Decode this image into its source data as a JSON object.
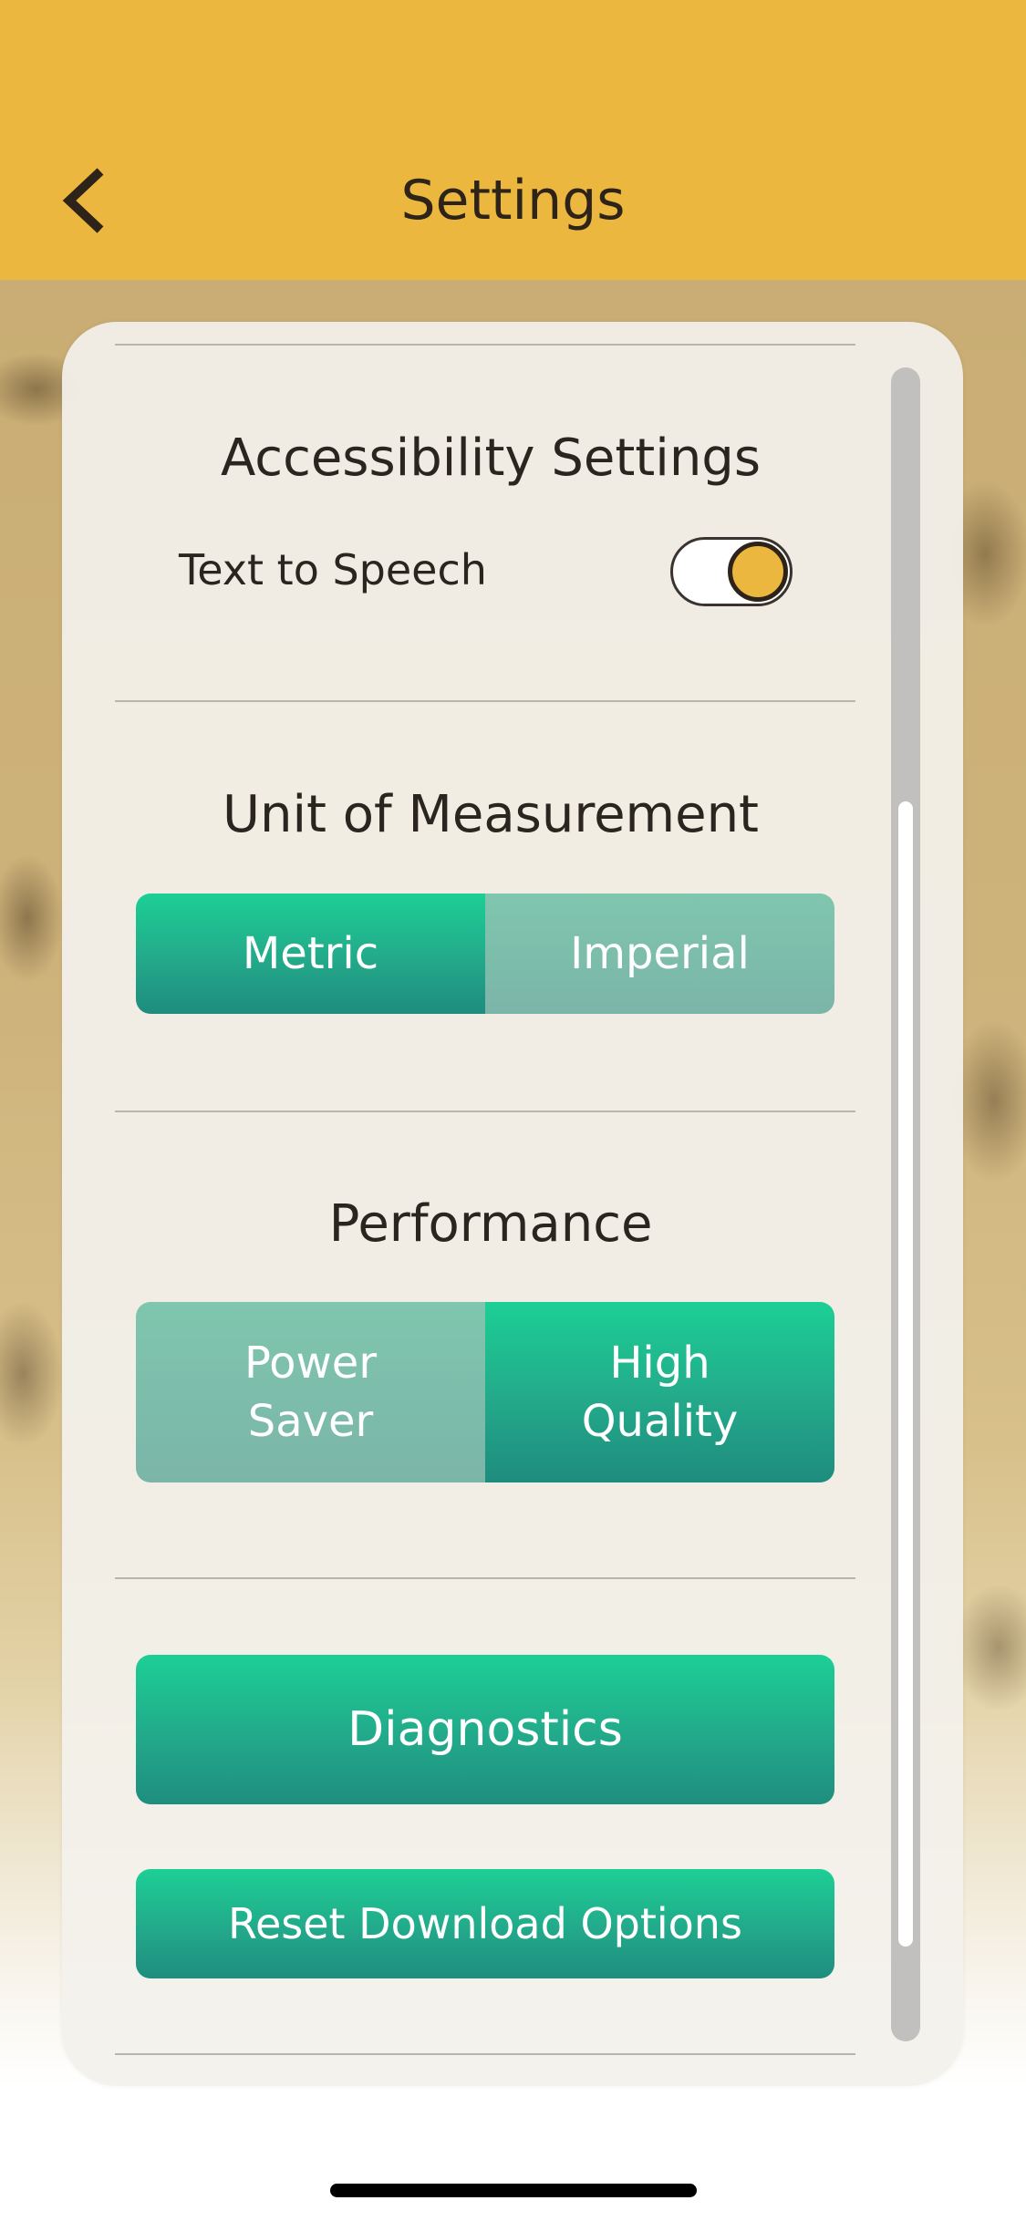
{
  "header": {
    "title": "Settings",
    "back_icon": "chevron-left-icon",
    "background_color": "#ecb73e"
  },
  "accessibility": {
    "title": "Accessibility Settings",
    "text_to_speech_label": "Text to Speech",
    "text_to_speech_enabled": true
  },
  "unit_of_measurement": {
    "title": "Unit of Measurement",
    "options": [
      "Metric",
      "Imperial"
    ],
    "selected": "Metric"
  },
  "performance": {
    "title": "Performance",
    "options": [
      "Power\nSaver",
      "High\nQuality"
    ],
    "selected": "High\nQuality"
  },
  "actions": {
    "diagnostics_label": "Diagnostics",
    "reset_download_label": "Reset Download Options"
  },
  "colors": {
    "accent_yellow": "#ecb73e",
    "button_green": "#1ccf95",
    "button_teal": "#1e8c7e"
  }
}
